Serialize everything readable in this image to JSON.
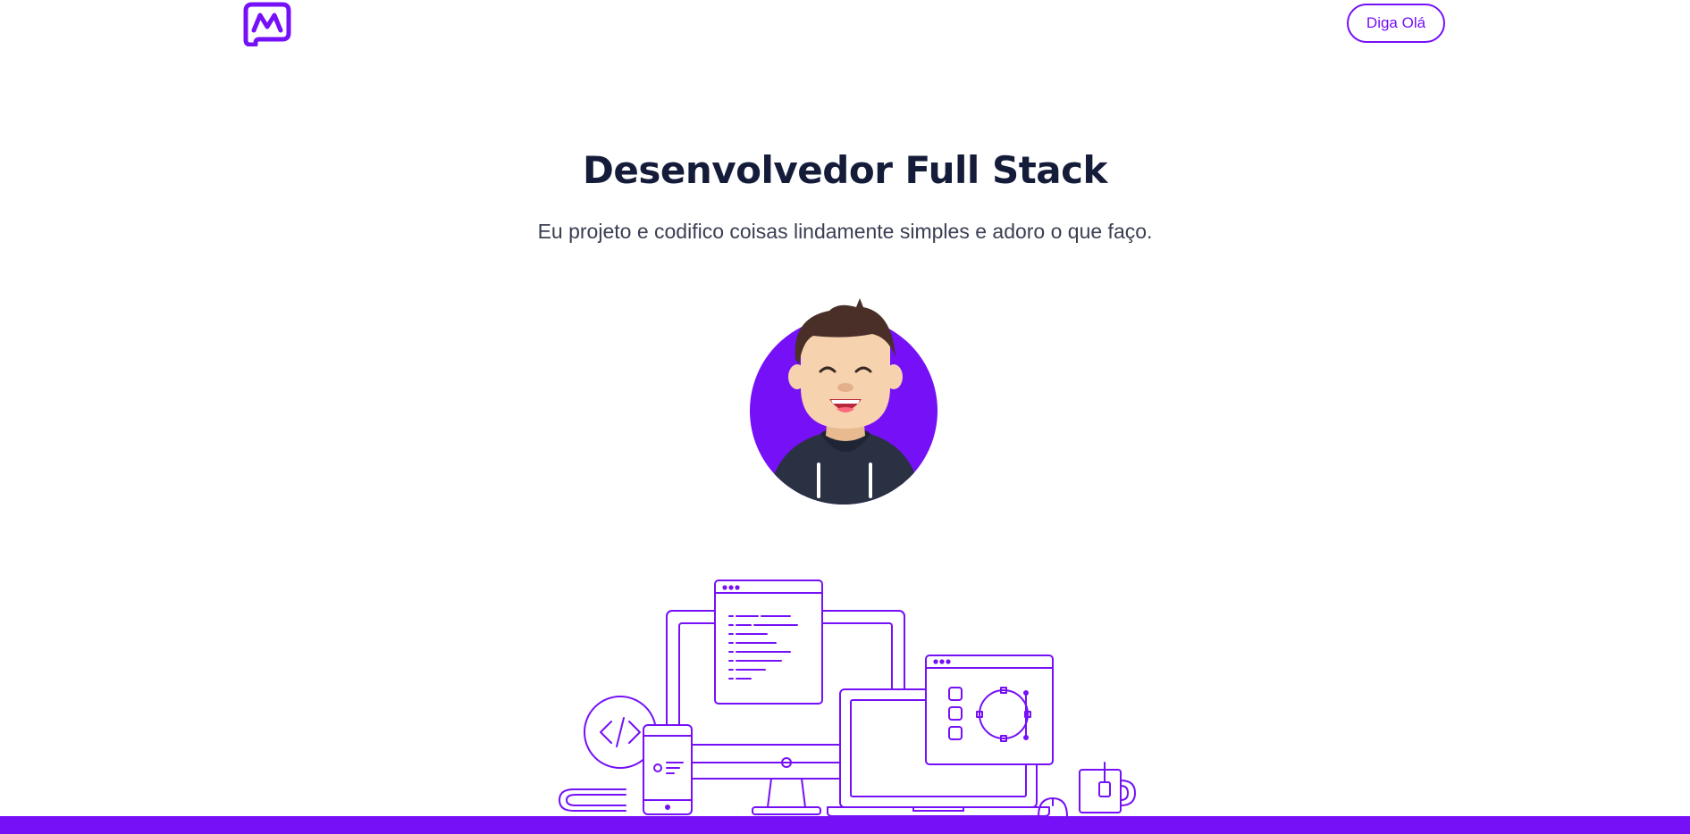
{
  "header": {
    "logo_icon": "mf-logo-icon",
    "cta_label": "Diga Olá"
  },
  "hero": {
    "title": "Desenvolvedor Full Stack",
    "subtitle": "Eu projeto e codifico coisas lindamente simples e adoro o que faço.",
    "avatar_icon": "avatar-illustration",
    "devices_icon": "devices-illustration"
  },
  "colors": {
    "accent": "#7510f7",
    "heading": "#141c3a",
    "text": "#3a3f52",
    "background": "#ffffff"
  }
}
